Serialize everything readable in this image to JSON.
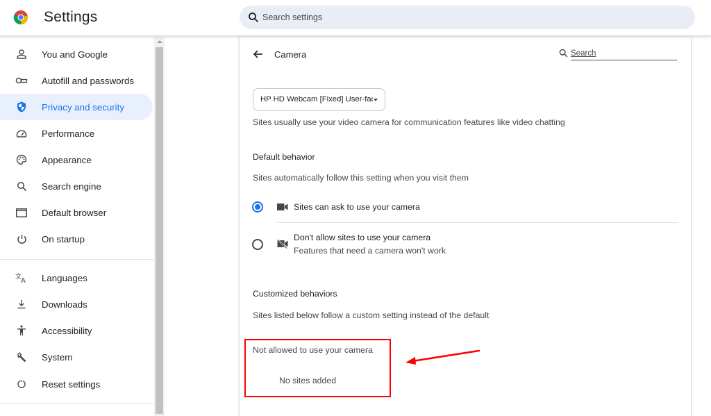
{
  "header": {
    "app_title": "Settings",
    "search_placeholder": "Search settings"
  },
  "sidebar": {
    "items": [
      {
        "label": "You and Google",
        "icon": "person-icon",
        "active": false
      },
      {
        "label": "Autofill and passwords",
        "icon": "key-icon",
        "active": false
      },
      {
        "label": "Privacy and security",
        "icon": "shield-icon",
        "active": true
      },
      {
        "label": "Performance",
        "icon": "speedometer-icon",
        "active": false
      },
      {
        "label": "Appearance",
        "icon": "palette-icon",
        "active": false
      },
      {
        "label": "Search engine",
        "icon": "search-icon",
        "active": false
      },
      {
        "label": "Default browser",
        "icon": "browser-window-icon",
        "active": false
      },
      {
        "label": "On startup",
        "icon": "power-icon",
        "active": false
      },
      {
        "label": "Languages",
        "icon": "translate-icon",
        "active": false
      },
      {
        "label": "Downloads",
        "icon": "download-icon",
        "active": false
      },
      {
        "label": "Accessibility",
        "icon": "accessibility-icon",
        "active": false
      },
      {
        "label": "System",
        "icon": "wrench-icon",
        "active": false
      },
      {
        "label": "Reset settings",
        "icon": "reset-icon",
        "active": false
      }
    ]
  },
  "camera_page": {
    "title": "Camera",
    "search_placeholder": "Search",
    "device_select": {
      "selected": "HP HD Webcam [Fixed] User-facing"
    },
    "description": "Sites usually use your video camera for communication features like video chatting",
    "default_behavior": {
      "heading": "Default behavior",
      "description": "Sites automatically follow this setting when you visit them",
      "options": [
        {
          "label": "Sites can ask to use your camera",
          "sublabel": "",
          "checked": true,
          "icon": "camera-icon"
        },
        {
          "label": "Don't allow sites to use your camera",
          "sublabel": "Features that need a camera won't work",
          "checked": false,
          "icon": "camera-off-icon"
        }
      ]
    },
    "customized_behaviors": {
      "heading": "Customized behaviors",
      "description": "Sites listed below follow a custom setting instead of the default",
      "not_allowed_heading": "Not allowed to use your camera",
      "empty_text": "No sites added"
    }
  },
  "annotation": {
    "color": "#ff0000"
  },
  "colors": {
    "accent": "#1a73e8",
    "active_nav_bg": "#e8f0fe",
    "search_bg": "#e9edf6"
  }
}
